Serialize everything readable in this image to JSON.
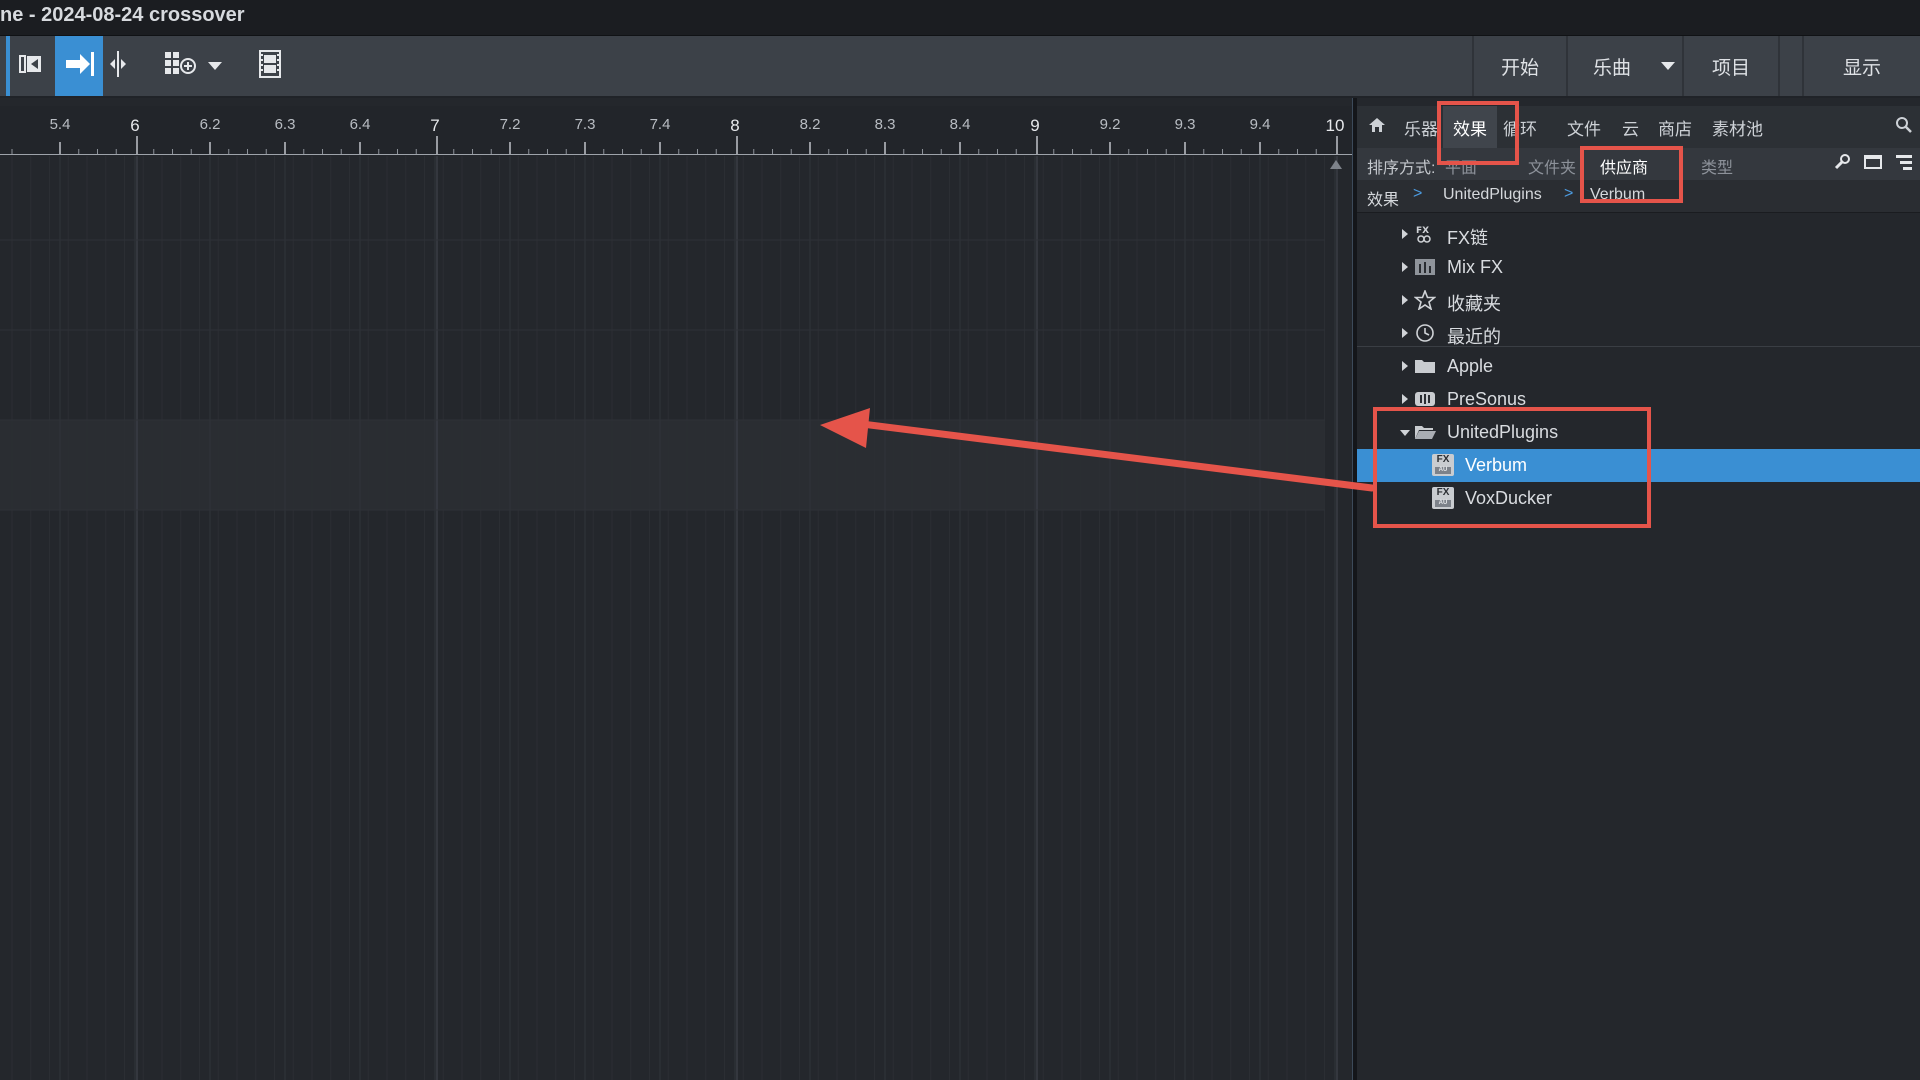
{
  "window": {
    "title": "ne - 2024-08-24 crossover"
  },
  "toolbar": {
    "nav": [
      "开始",
      "乐曲",
      "项目",
      "显示"
    ]
  },
  "ruler": {
    "ticks": [
      {
        "label": "5.4",
        "major": false
      },
      {
        "label": "6",
        "major": true
      },
      {
        "label": "6.2",
        "major": false
      },
      {
        "label": "6.3",
        "major": false
      },
      {
        "label": "6.4",
        "major": false
      },
      {
        "label": "7",
        "major": true
      },
      {
        "label": "7.2",
        "major": false
      },
      {
        "label": "7.3",
        "major": false
      },
      {
        "label": "7.4",
        "major": false
      },
      {
        "label": "8",
        "major": true
      },
      {
        "label": "8.2",
        "major": false
      },
      {
        "label": "8.3",
        "major": false
      },
      {
        "label": "8.4",
        "major": false
      },
      {
        "label": "9",
        "major": true
      },
      {
        "label": "9.2",
        "major": false
      },
      {
        "label": "9.3",
        "major": false
      },
      {
        "label": "9.4",
        "major": false
      },
      {
        "label": "10",
        "major": true
      }
    ]
  },
  "browser": {
    "tabs": [
      "乐器",
      "效果",
      "循环",
      "文件",
      "云",
      "商店",
      "素材池"
    ],
    "active_tab": "效果",
    "sort_label": "排序方式:",
    "sort_options": [
      "平面",
      "文件夹",
      "供应商",
      "类型"
    ],
    "active_sort": "供应商",
    "breadcrumb": [
      "效果",
      "UnitedPlugins",
      "Verbum"
    ],
    "tree": [
      {
        "label": "FX链",
        "icon": "fx-chain-icon",
        "expanded": false,
        "indent": 0
      },
      {
        "label": "Mix FX",
        "icon": "mix-fx-icon",
        "expanded": false,
        "indent": 0
      },
      {
        "label": "收藏夹",
        "icon": "star-icon",
        "expanded": false,
        "indent": 0
      },
      {
        "label": "最近的",
        "icon": "clock-icon",
        "expanded": false,
        "indent": 0
      },
      {
        "label": "Apple",
        "icon": "folder-icon",
        "expanded": false,
        "indent": 0
      },
      {
        "label": "PreSonus",
        "icon": "presonus-icon",
        "expanded": false,
        "indent": 0
      },
      {
        "label": "UnitedPlugins",
        "icon": "folder-open-icon",
        "expanded": true,
        "indent": 0
      },
      {
        "label": "Verbum",
        "icon": "fx-au-icon",
        "indent": 1,
        "selected": true
      },
      {
        "label": "VoxDucker",
        "icon": "fx-au-icon",
        "indent": 1
      }
    ]
  },
  "colors": {
    "accent": "#3a8fd3",
    "annotation": "#e5544a",
    "toolbar_bg": "#3c4148",
    "panel_bg": "#24272c"
  }
}
